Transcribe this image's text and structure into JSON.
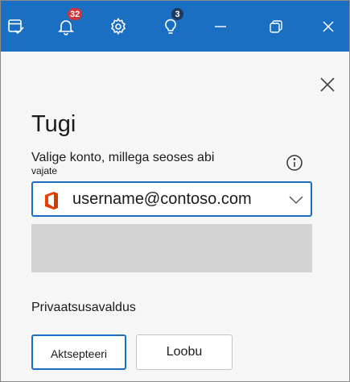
{
  "titlebar": {
    "notifications_badge": "32",
    "tips_badge": "3",
    "accent_color": "#1a6fc2",
    "icons": [
      "calendar-check-icon",
      "bell-icon",
      "gear-icon",
      "lightbulb-icon",
      "minimize-icon",
      "restore-icon",
      "close-icon"
    ]
  },
  "pane": {
    "title": "Tugi",
    "prompt_line1": "Valige konto, millega seoses abi",
    "prompt_line2": "vajate",
    "account": {
      "value": "username@contoso.com",
      "icon": "office-icon"
    },
    "privacy_label": "Privaatsusavaldus",
    "accept_label": "Aktsepteeri",
    "cancel_label": "Loobu"
  }
}
